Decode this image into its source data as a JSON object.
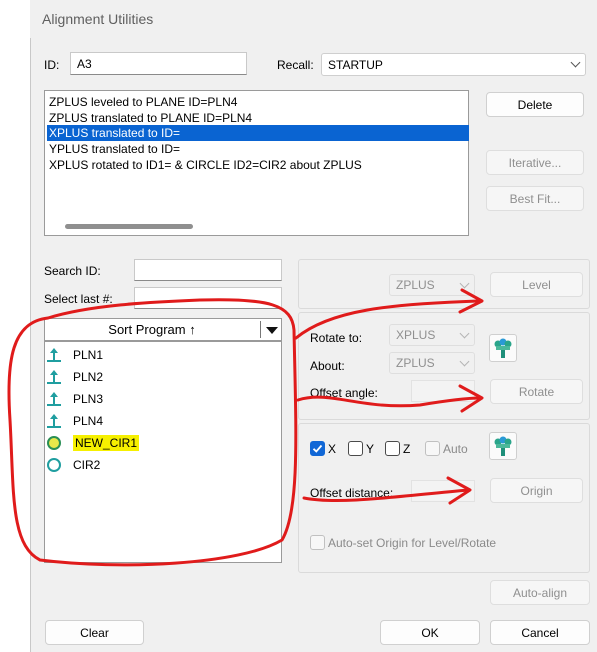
{
  "window": {
    "title": "Alignment Utilities"
  },
  "id_field": {
    "label": "ID:",
    "value": "A3"
  },
  "recall": {
    "label": "Recall:",
    "value": "STARTUP"
  },
  "alignment_list": [
    "ZPLUS leveled to PLANE ID=PLN4",
    "ZPLUS translated to PLANE ID=PLN4",
    "XPLUS translated to  ID=",
    "YPLUS translated to  ID=",
    "XPLUS rotated to  ID1= & CIRCLE ID2=CIR2 about ZPLUS"
  ],
  "selected_index": 2,
  "buttons": {
    "delete": "Delete",
    "iterative": "Iterative...",
    "best_fit": "Best Fit...",
    "level": "Level",
    "rotate": "Rotate",
    "origin": "Origin",
    "auto_align": "Auto-align",
    "clear": "Clear",
    "ok": "OK",
    "cancel": "Cancel"
  },
  "search": {
    "label": "Search ID:",
    "value": ""
  },
  "select_last": {
    "label": "Select last #:",
    "value": ""
  },
  "sort": {
    "label": "Sort Program ↑"
  },
  "features": [
    {
      "name": "PLN1",
      "type": "plane"
    },
    {
      "name": "PLN2",
      "type": "plane"
    },
    {
      "name": "PLN3",
      "type": "plane"
    },
    {
      "name": "PLN4",
      "type": "plane"
    },
    {
      "name": "NEW_CIR1",
      "type": "circle",
      "highlighted": true
    },
    {
      "name": "CIR2",
      "type": "circle"
    }
  ],
  "level": {
    "axis": "ZPLUS"
  },
  "rotate": {
    "rotate_to_label": "Rotate to:",
    "rotate_to_value": "XPLUS",
    "about_label": "About:",
    "about_value": "ZPLUS",
    "offset_angle_label": "Offset angle:"
  },
  "origin": {
    "x_label": "X",
    "x_checked": true,
    "y_label": "Y",
    "y_checked": false,
    "z_label": "Z",
    "z_checked": false,
    "auto_label": "Auto",
    "offset_distance_label": "Offset distance:",
    "auto_set_label": "Auto-set Origin for Level/Rotate"
  },
  "colors": {
    "selection": "#0a64d2",
    "annotation": "#e01b1b",
    "highlight": "#f6f000",
    "icon": "#1f9ea0"
  }
}
